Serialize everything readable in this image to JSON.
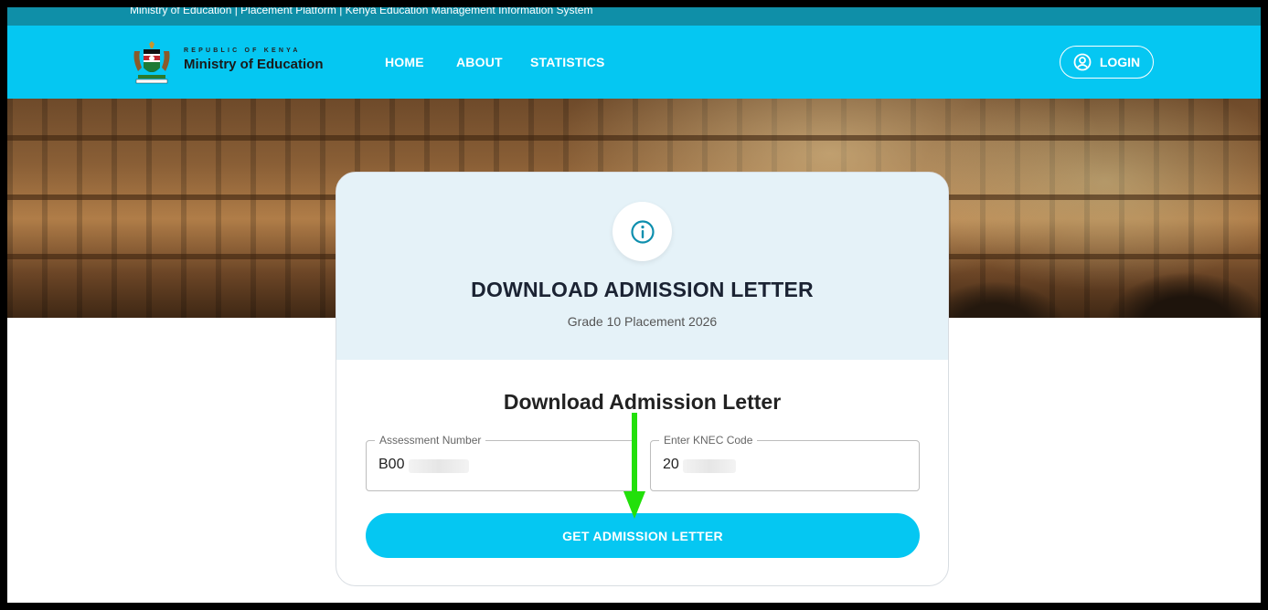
{
  "topbar": {
    "text": "Ministry of Education | Placement Platform | Kenya Education Management Information System"
  },
  "brand": {
    "republic": "REPUBLIC OF KENYA",
    "ministry": "Ministry of Education",
    "crest_caption": "REPUBLIC OF KENYA"
  },
  "nav": {
    "items": [
      {
        "label": "HOME"
      },
      {
        "label": "ABOUT"
      },
      {
        "label": "STATISTICS"
      }
    ],
    "login_label": "LOGIN"
  },
  "card": {
    "title": "DOWNLOAD ADMISSION LETTER",
    "subtitle": "Grade 10 Placement 2026"
  },
  "form": {
    "title": "Download Admission Letter",
    "assessment": {
      "label": "Assessment Number",
      "value": "B00"
    },
    "knec": {
      "label": "Enter KNEC Code",
      "value": "20"
    },
    "submit_label": "GET ADMISSION LETTER"
  },
  "colors": {
    "accent": "#05c7f2",
    "topbar": "#0f8fa8",
    "card_header": "#e5f2f8",
    "info_icon": "#0e8fae",
    "annotation_arrow": "#22e00a"
  },
  "icons": {
    "info": "info-icon",
    "user": "user-circle-icon",
    "crest": "coat-of-arms-icon",
    "arrow": "down-arrow-icon"
  }
}
